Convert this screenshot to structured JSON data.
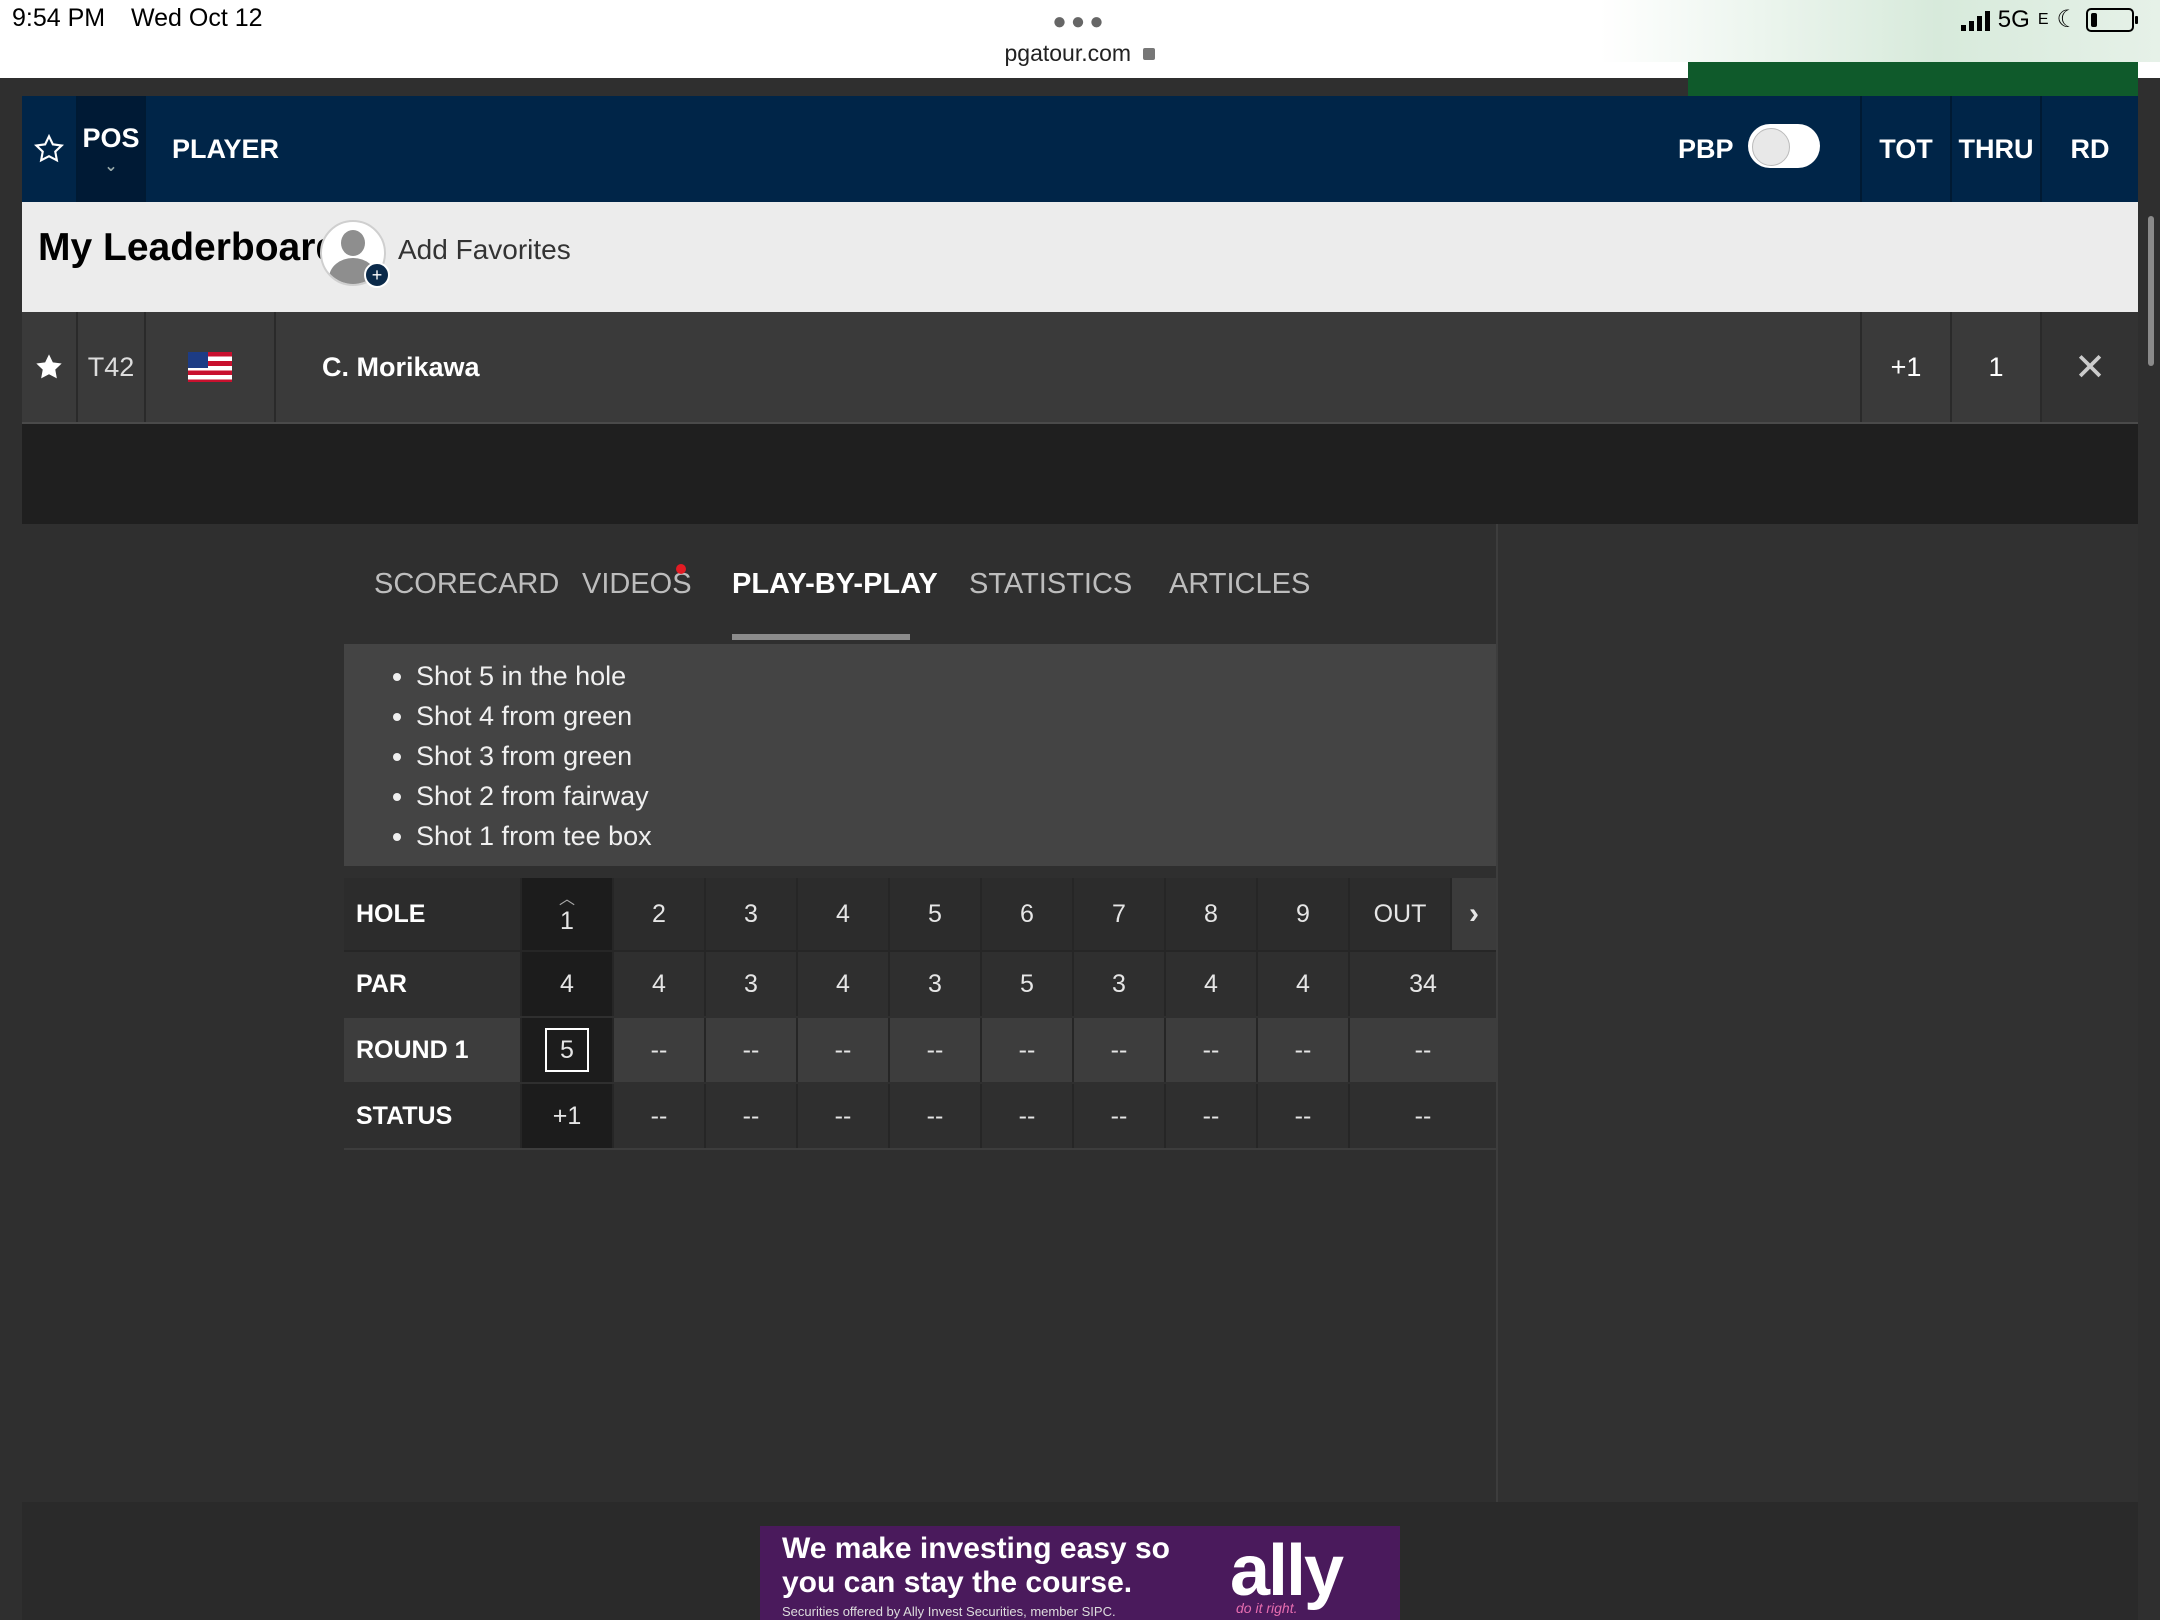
{
  "status_bar": {
    "time": "9:54 PM",
    "date": "Wed Oct 12",
    "url": "pgatour.com",
    "network": "5G",
    "network_suffix": "E"
  },
  "header": {
    "pos": "POS",
    "player": "PLAYER",
    "pbp": "PBP",
    "tot": "TOT",
    "thru": "THRU",
    "rd": "RD"
  },
  "my_leaderboard": {
    "title": "My Leaderboard",
    "add_favorites": "Add Favorites"
  },
  "player_row": {
    "position": "T42",
    "name": "C. Morikawa",
    "total": "+1",
    "thru": "1"
  },
  "tabs": {
    "scorecard": "SCORECARD",
    "videos": "VIDEOS",
    "play_by_play": "PLAY-BY-PLAY",
    "statistics": "STATISTICS",
    "articles": "ARTICLES"
  },
  "play_by_play": [
    "Shot 5 in the hole",
    "Shot 4 from green",
    "Shot 3 from green",
    "Shot 2 from fairway",
    "Shot 1 from tee box"
  ],
  "scorecard": {
    "labels": {
      "hole": "HOLE",
      "par": "PAR",
      "round": "ROUND 1",
      "status": "STATUS"
    },
    "holes": [
      "1",
      "2",
      "3",
      "4",
      "5",
      "6",
      "7",
      "8",
      "9",
      "OUT"
    ],
    "par": [
      "4",
      "4",
      "3",
      "4",
      "3",
      "5",
      "3",
      "4",
      "4",
      "34"
    ],
    "round1": [
      "5",
      "--",
      "--",
      "--",
      "--",
      "--",
      "--",
      "--",
      "--",
      "--"
    ],
    "status": [
      "+1",
      "--",
      "--",
      "--",
      "--",
      "--",
      "--",
      "--",
      "--",
      "--"
    ]
  },
  "ad": {
    "line1": "We make investing easy so",
    "line2": "you can stay the course.",
    "disclaimer": "Securities offered by Ally Invest Securities, member SIPC.",
    "brand": "ally",
    "tagline": "do it right."
  }
}
